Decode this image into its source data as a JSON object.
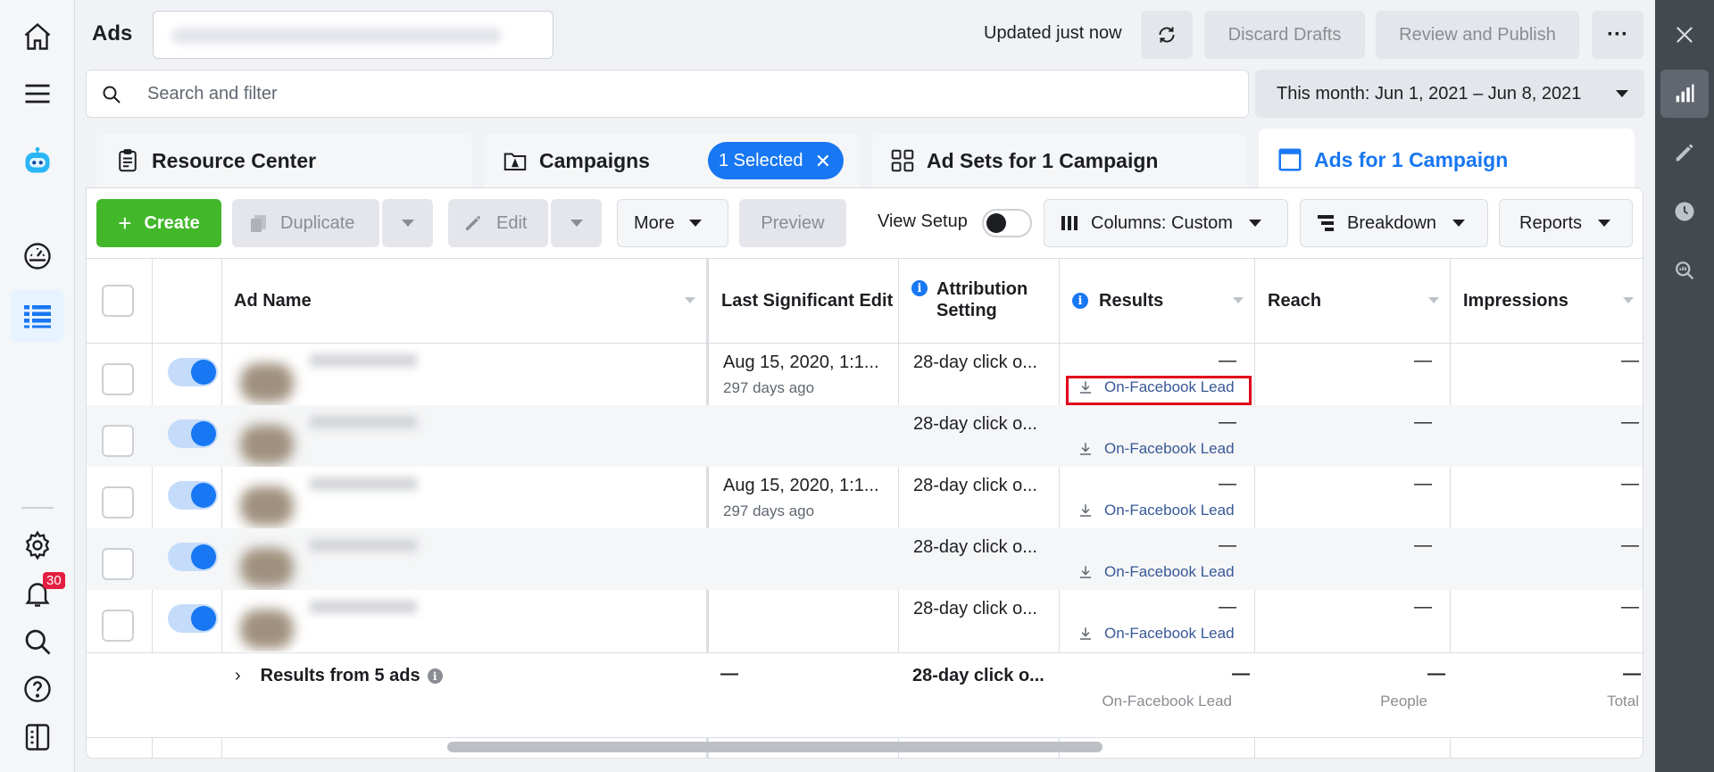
{
  "header": {
    "title": "Ads",
    "updated": "Updated just now",
    "discard_label": "Discard Drafts",
    "review_label": "Review and Publish",
    "more_label": "···"
  },
  "search": {
    "placeholder": "Search and filter"
  },
  "date_range": "This month: Jun 1, 2021 – Jun 8, 2021",
  "tabs": [
    {
      "label": "Resource Center"
    },
    {
      "label": "Campaigns",
      "selected": "1 Selected"
    },
    {
      "label": "Ad Sets for 1 Campaign"
    },
    {
      "label": "Ads for 1 Campaign"
    }
  ],
  "toolbar": {
    "create": "Create",
    "duplicate": "Duplicate",
    "edit": "Edit",
    "more": "More",
    "preview": "Preview",
    "view_setup": "View Setup",
    "columns": "Columns: Custom",
    "breakdown": "Breakdown",
    "reports": "Reports"
  },
  "table": {
    "headers": {
      "ad_name": "Ad Name",
      "last_edit": "Last Significant Edit",
      "attribution": "Attribution Setting",
      "results": "Results",
      "reach": "Reach",
      "impressions": "Impressions"
    },
    "rows": [
      {
        "last_edit": "Aug 15, 2020, 1:1...",
        "last_edit_sub": "297 days ago",
        "attribution": "28-day click o...",
        "results": "—",
        "results_type": "On-Facebook Lead",
        "reach": "—",
        "impressions": "—"
      },
      {
        "last_edit": "",
        "last_edit_sub": "",
        "attribution": "28-day click o...",
        "results": "—",
        "results_type": "On-Facebook Lead",
        "reach": "—",
        "impressions": "—"
      },
      {
        "last_edit": "Aug 15, 2020, 1:1...",
        "last_edit_sub": "297 days ago",
        "attribution": "28-day click o...",
        "results": "—",
        "results_type": "On-Facebook Lead",
        "reach": "—",
        "impressions": "—"
      },
      {
        "last_edit": "",
        "last_edit_sub": "",
        "attribution": "28-day click o...",
        "results": "—",
        "results_type": "On-Facebook Lead",
        "reach": "—",
        "impressions": "—"
      },
      {
        "last_edit": "",
        "last_edit_sub": "",
        "attribution": "28-day click o...",
        "results": "—",
        "results_type": "On-Facebook Lead",
        "reach": "—",
        "impressions": "—"
      }
    ],
    "summary": {
      "label": "Results from 5 ads",
      "last_edit": "—",
      "attribution": "28-day click o...",
      "results": "—",
      "results_sub": "On-Facebook Lead",
      "reach": "—",
      "reach_sub": "People",
      "impressions": "—",
      "impressions_sub": "Total"
    }
  },
  "notifications": {
    "count": "30"
  },
  "colors": {
    "primary": "#1877f2",
    "create": "#42b72a",
    "highlight": "#e0001a",
    "rail": "#444950"
  }
}
